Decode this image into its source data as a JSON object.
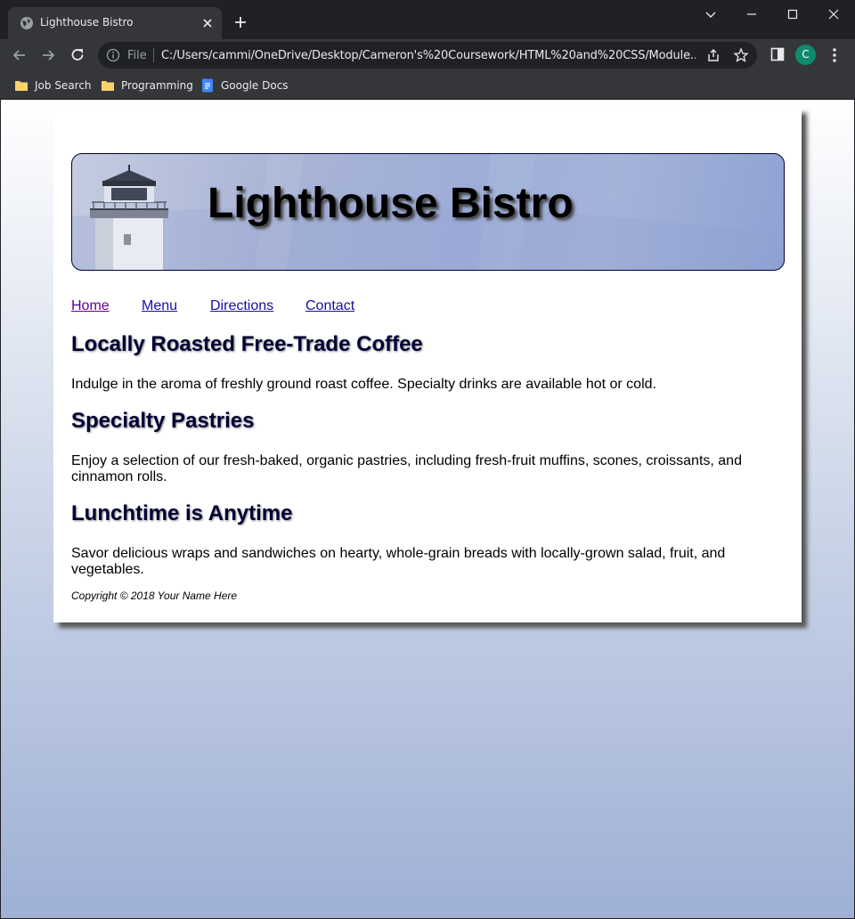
{
  "browser": {
    "tab_title": "Lighthouse Bistro",
    "omnibox": {
      "scheme_label": "File",
      "url": "C:/Users/cammi/OneDrive/Desktop/Cameron's%20Coursework/HTML%20and%20CSS/Module..."
    },
    "profile_initial": "C",
    "bookmarks": [
      {
        "label": "Job Search",
        "icon": "folder-icon"
      },
      {
        "label": "Programming",
        "icon": "folder-icon"
      },
      {
        "label": "Google Docs",
        "icon": "google-docs-icon"
      }
    ]
  },
  "page": {
    "hero_title": "Lighthouse Bistro",
    "nav": [
      {
        "label": "Home"
      },
      {
        "label": "Menu"
      },
      {
        "label": "Directions"
      },
      {
        "label": "Contact"
      }
    ],
    "sections": [
      {
        "heading": "Locally Roasted Free-Trade Coffee",
        "text": "Indulge in the aroma of freshly ground roast coffee. Specialty drinks are available hot or cold."
      },
      {
        "heading": "Specialty Pastries",
        "text": "Enjoy a selection of our fresh-baked, organic pastries, including fresh-fruit muffins, scones, croissants, and cinnamon rolls."
      },
      {
        "heading": "Lunchtime is Anytime",
        "text": "Savor delicious wraps and sandwiches on hearty, whole-grain breads with locally-grown salad, fruit, and vegetables."
      }
    ],
    "footer": "Copyright © 2018 Your Name Here"
  },
  "colors": {
    "heading": "#000033",
    "link": "#1a0dab",
    "link_visited": "#660099",
    "profile_avatar": "#0e8a6e"
  }
}
